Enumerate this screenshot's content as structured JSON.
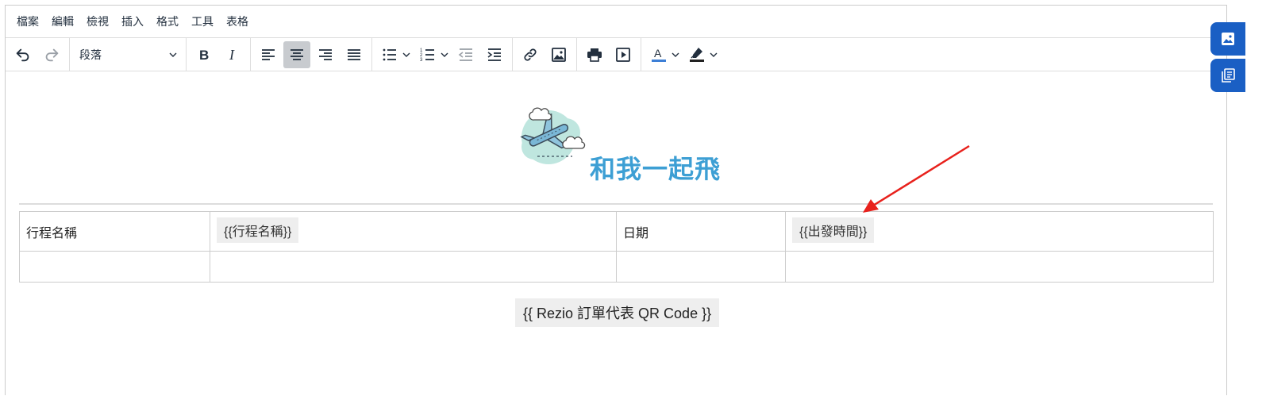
{
  "menubar": {
    "items": [
      "檔案",
      "編輯",
      "檢視",
      "插入",
      "格式",
      "工具",
      "表格"
    ]
  },
  "toolbar": {
    "block_format": "段落",
    "icons": [
      "undo-icon",
      "redo-icon",
      "bold-icon",
      "italic-icon",
      "align-left-icon",
      "align-center-icon",
      "align-right-icon",
      "align-justify-icon",
      "bullet-list-icon",
      "numbered-list-icon",
      "outdent-icon",
      "indent-icon",
      "link-icon",
      "image-icon",
      "print-icon",
      "media-icon",
      "text-color-icon",
      "highlight-icon"
    ],
    "active": "align-center",
    "text_color_swatch": "#3d7fd6",
    "highlight_swatch": "#222222"
  },
  "document": {
    "brand_title": "和我一起飛",
    "brand_color": "#3d9fd4",
    "table": {
      "rows": [
        [
          "行程名稱",
          "{{行程名稱}}",
          "日期",
          "{{出發時間}}"
        ],
        [
          "",
          "",
          "",
          ""
        ]
      ]
    },
    "qr_placeholder": "{{ Rezio 訂單代表 QR Code }}"
  },
  "side_panel": {
    "buttons": [
      "image-gallery-icon",
      "template-list-icon"
    ],
    "color": "#1a5fc4"
  },
  "annotation": {
    "arrow_color": "#e8211c"
  }
}
